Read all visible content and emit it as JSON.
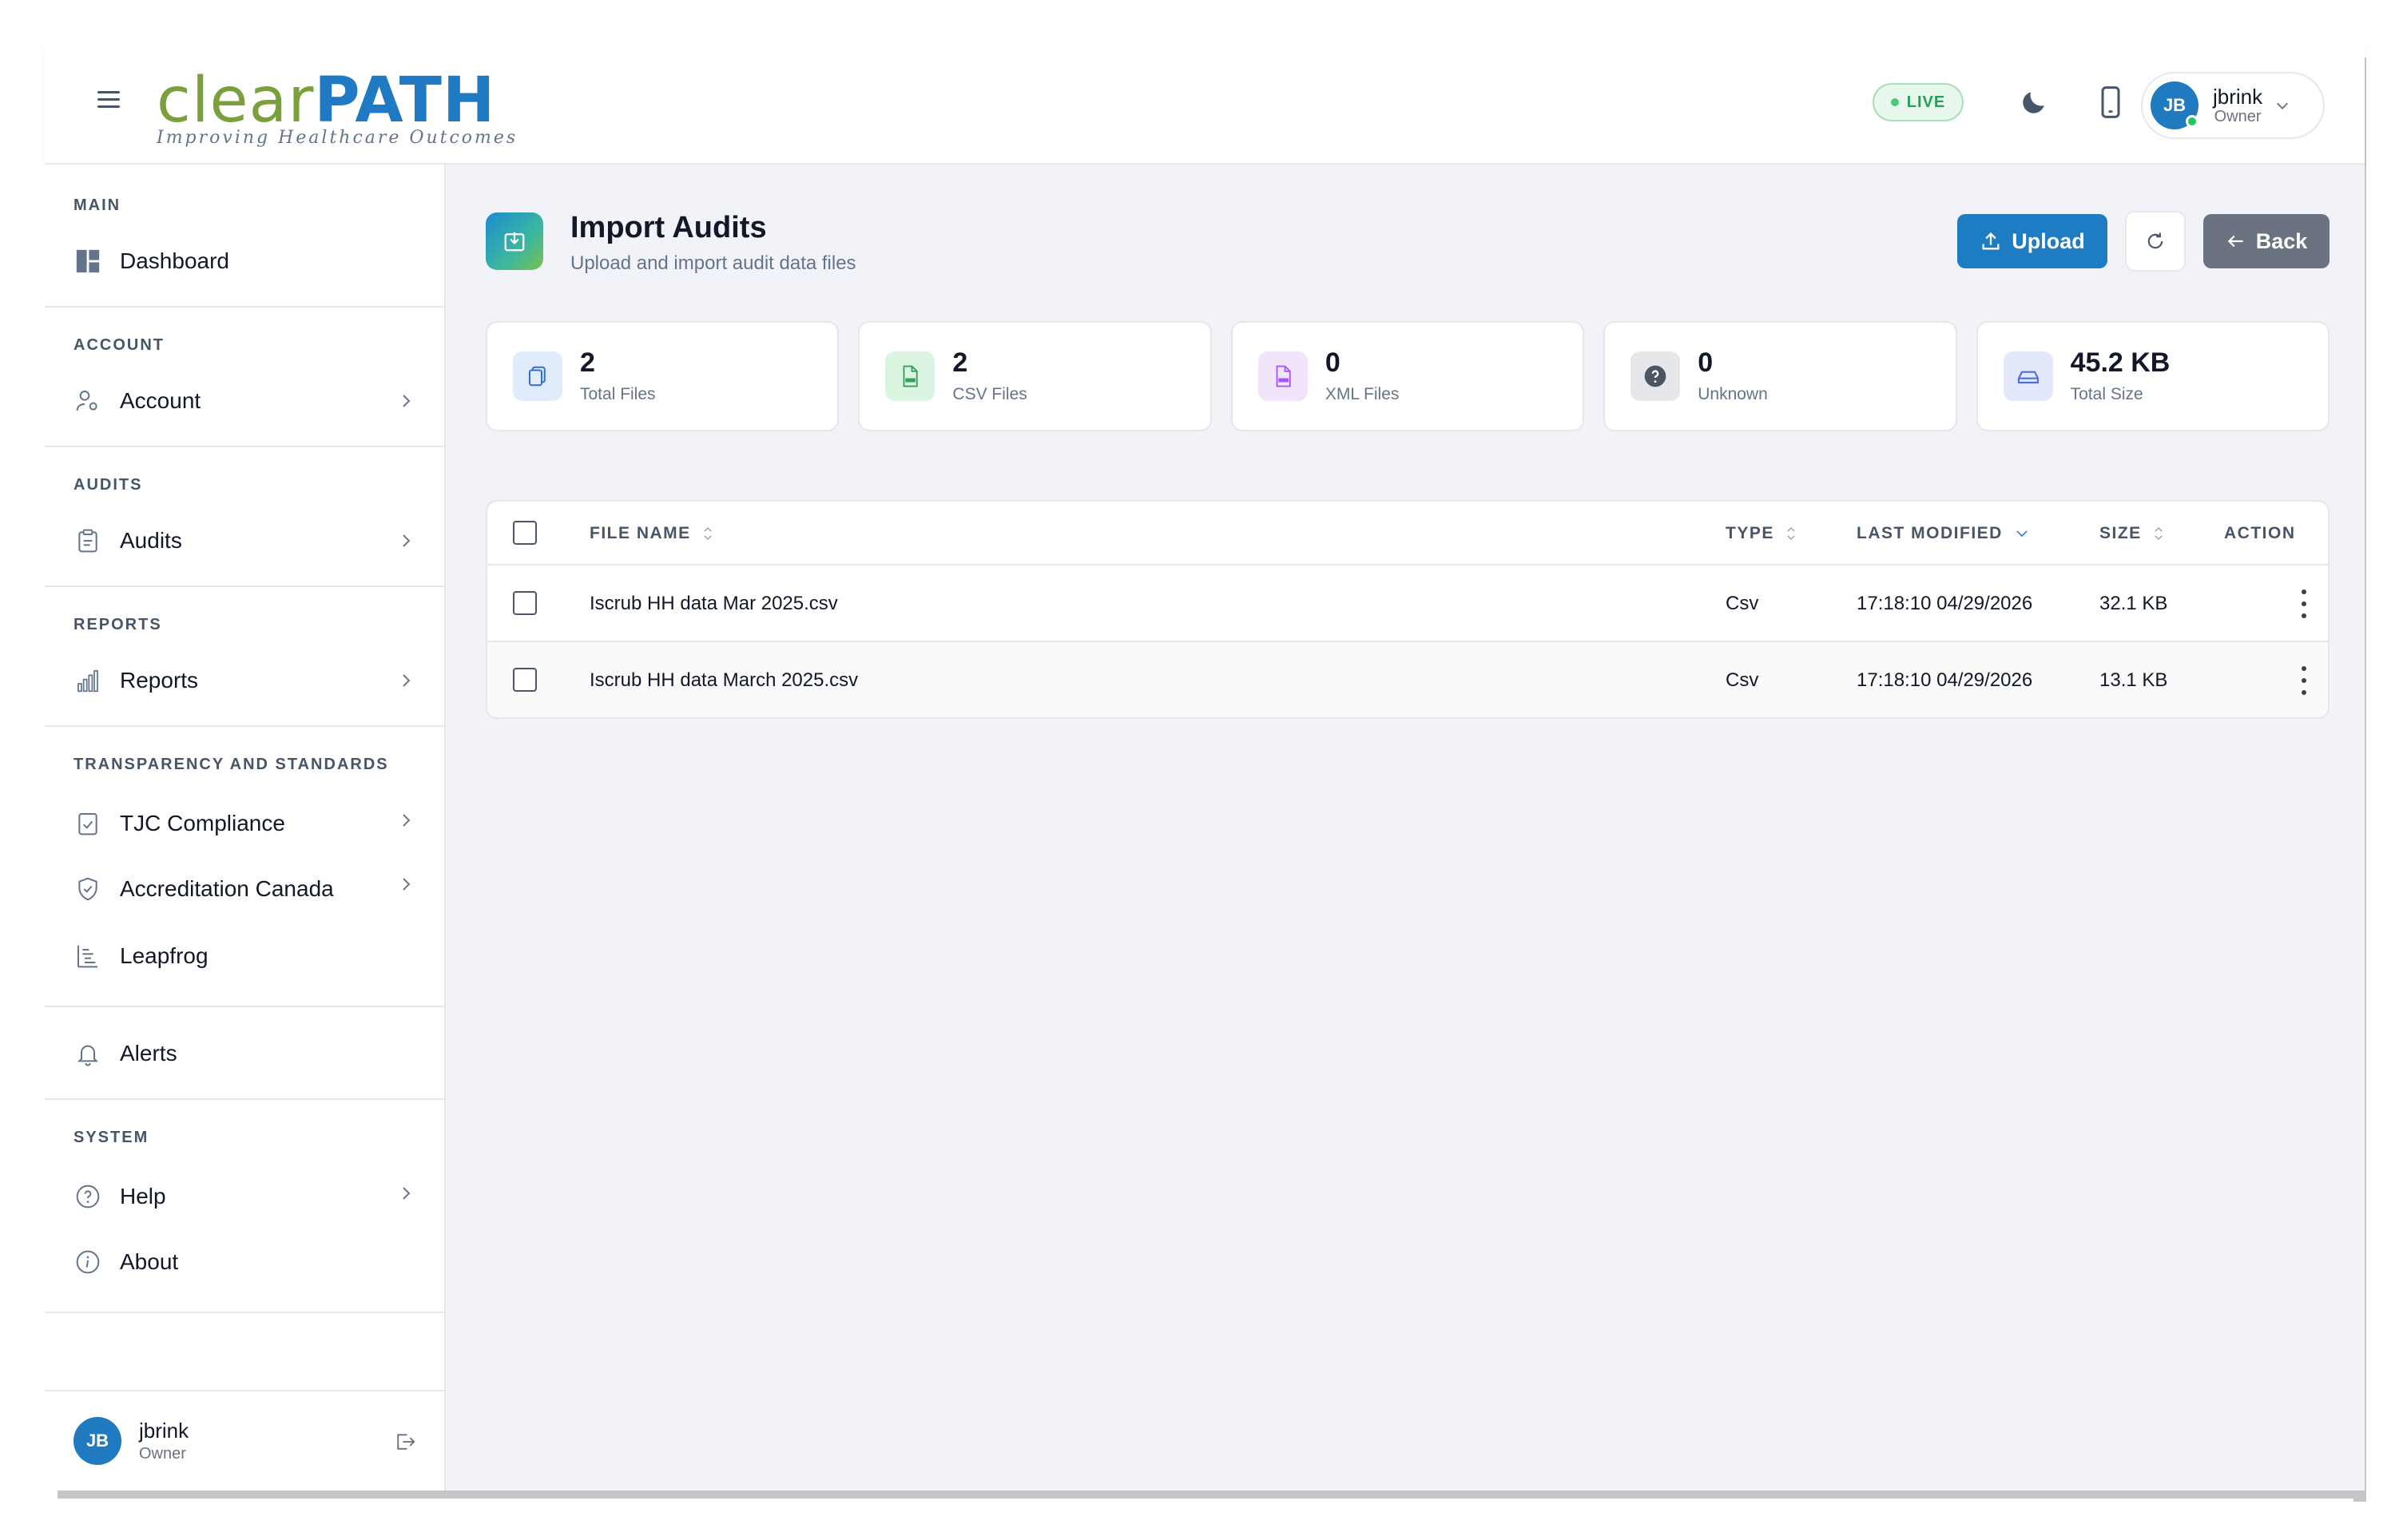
{
  "header": {
    "logo_part1": "clear",
    "logo_part2": "PATH",
    "tagline": "Improving Healthcare Outcomes",
    "live_label": "LIVE",
    "user": {
      "initials": "JB",
      "name": "jbrink",
      "role": "Owner"
    }
  },
  "sidebar": {
    "sections": {
      "main": "MAIN",
      "account": "ACCOUNT",
      "audits": "AUDITS",
      "reports": "REPORTS",
      "transparency": "TRANSPARENCY AND STANDARDS",
      "system": "SYSTEM"
    },
    "items": {
      "dashboard": "Dashboard",
      "account": "Account",
      "audits": "Audits",
      "reports": "Reports",
      "tjc": "TJC Compliance",
      "accreditation": "Accreditation Canada",
      "leapfrog": "Leapfrog",
      "alerts": "Alerts",
      "help": "Help",
      "about": "About"
    },
    "footer_user": {
      "initials": "JB",
      "name": "jbrink",
      "role": "Owner"
    }
  },
  "page": {
    "title": "Import Audits",
    "subtitle": "Upload and import audit data files",
    "upload_label": "Upload",
    "back_label": "Back"
  },
  "stats": [
    {
      "value": "2",
      "label": "Total Files"
    },
    {
      "value": "2",
      "label": "CSV Files"
    },
    {
      "value": "0",
      "label": "XML Files"
    },
    {
      "value": "0",
      "label": "Unknown"
    },
    {
      "value": "45.2 KB",
      "label": "Total Size"
    }
  ],
  "table": {
    "columns": {
      "file_name": "FILE NAME",
      "type": "TYPE",
      "last_modified": "LAST MODIFIED",
      "size": "SIZE",
      "action": "ACTION"
    },
    "rows": [
      {
        "file_name": "Iscrub HH data Mar 2025.csv",
        "type": "Csv",
        "last_modified": "17:18:10 04/29/2026",
        "size": "32.1 KB"
      },
      {
        "file_name": "Iscrub HH data March 2025.csv",
        "type": "Csv",
        "last_modified": "17:18:10 04/29/2026",
        "size": "13.1 KB"
      }
    ]
  },
  "colors": {
    "brand_green": "#7aa03c",
    "brand_blue": "#2079c3",
    "primary_button": "#1e7cc2",
    "back_button": "#6b7280",
    "live_green": "#22a05a"
  }
}
